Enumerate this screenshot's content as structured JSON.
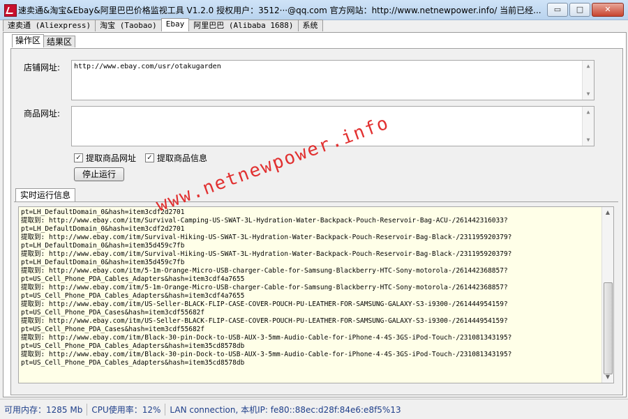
{
  "window": {
    "title": "速卖通&淘宝&Ebay&阿里巴巴价格监视工具 V1.2.0 授权用户：3512···@qq.com 官方网站：http://www.netnewpower.info/ 当前已经...",
    "controls": {
      "minimize": "▭",
      "maximize": "□",
      "close": "✕"
    }
  },
  "main_tabs": [
    {
      "label": "速卖通 (Aliexpress)"
    },
    {
      "label": "淘宝 (Taobao)"
    },
    {
      "label": "Ebay"
    },
    {
      "label": "阿里巴巴 (Alibaba 1688)"
    },
    {
      "label": "系统"
    }
  ],
  "sub_tabs": [
    {
      "label": "操作区"
    },
    {
      "label": "结果区"
    }
  ],
  "form": {
    "store_url_label": "店铺网址:",
    "store_url_value": "http://www.ebay.com/usr/otakugarden",
    "product_url_label": "商品网址:",
    "product_url_value": "",
    "chk_fetch_url": {
      "label": "提取商品网址",
      "checked": true
    },
    "chk_fetch_info": {
      "label": "提取商品信息",
      "checked": true
    },
    "stop_button": "停止运行"
  },
  "log": {
    "group_label": "实时运行信息",
    "lines": [
      "pt=LH_DefaultDomain_0&hash=item3cdf2d2701",
      "提取到: http://www.ebay.com/itm/Survival-Camping-US-SWAT-3L-Hydration-Water-Backpack-Pouch-Reservoir-Bag-ACU-/261442316033?",
      "pt=LH_DefaultDomain_0&hash=item3cdf2d2701",
      "提取到: http://www.ebay.com/itm/Survival-Hiking-US-SWAT-3L-Hydration-Water-Backpack-Pouch-Reservoir-Bag-Black-/231195920379?",
      "pt=LH_DefaultDomain_0&hash=item35d459c7fb",
      "提取到: http://www.ebay.com/itm/Survival-Hiking-US-SWAT-3L-Hydration-Water-Backpack-Pouch-Reservoir-Bag-Black-/231195920379?",
      "pt=LH_DefaultDomain_0&hash=item35d459c7fb",
      "提取到: http://www.ebay.com/itm/5-1m-Orange-Micro-USB-charger-Cable-for-Samsung-Blackberry-HTC-Sony-motorola-/261442368857?",
      "pt=US_Cell_Phone_PDA_Cables_Adapters&hash=item3cdf4a7655",
      "提取到: http://www.ebay.com/itm/5-1m-Orange-Micro-USB-charger-Cable-for-Samsung-Blackberry-HTC-Sony-motorola-/261442368857?",
      "pt=US_Cell_Phone_PDA_Cables_Adapters&hash=item3cdf4a7655",
      "提取到: http://www.ebay.com/itm/US-Seller-BLACK-FLIP-CASE-COVER-POUCH-PU-LEATHER-FOR-SAMSUNG-GALAXY-S3-i9300-/261444954159?",
      "pt=US_Cell_Phone_PDA_Cases&hash=item3cdf55682f",
      "提取到: http://www.ebay.com/itm/US-Seller-BLACK-FLIP-CASE-COVER-POUCH-PU-LEATHER-FOR-SAMSUNG-GALAXY-S3-i9300-/261444954159?",
      "pt=US_Cell_Phone_PDA_Cases&hash=item3cdf55682f",
      "提取到: http://www.ebay.com/itm/Black-30-pin-Dock-to-USB-AUX-3-5mm-Audio-Cable-for-iPhone-4-4S-3GS-iPod-Touch-/231081343195?",
      "pt=US_Cell_Phone_PDA_Cables_Adapters&hash=item35cd8578db",
      "提取到: http://www.ebay.com/itm/Black-30-pin-Dock-to-USB-AUX-3-5mm-Audio-Cable-for-iPhone-4-4S-3GS-iPod-Touch-/231081343195?",
      "pt=US_Cell_Phone_PDA_Cables_Adapters&hash=item35cd8578db"
    ]
  },
  "watermark": "www.netnewpower.info",
  "status": {
    "memory": "可用内存：1285 Mb",
    "cpu": "CPU使用率：12%",
    "network": "LAN connection, 本机IP: fe80::88ec:d28f:84e6:e8f5%13"
  },
  "colors": {
    "log_bg": "#ffffe8",
    "watermark": "#e02020",
    "status_text": "#1f3f8a"
  }
}
